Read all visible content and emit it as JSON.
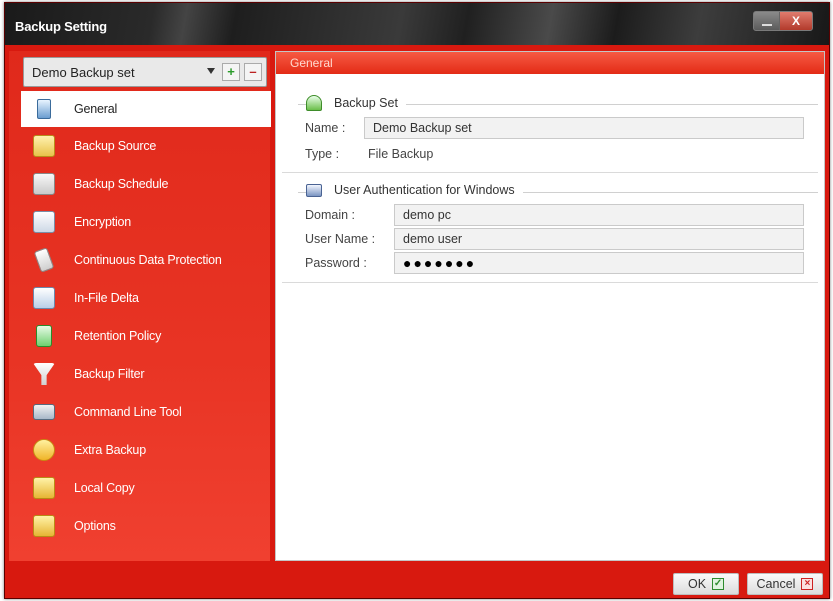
{
  "window": {
    "title": "Backup Setting",
    "close_glyph": "X"
  },
  "sidebar": {
    "selected_set": "Demo Backup set",
    "add_glyph": "+",
    "remove_glyph": "–",
    "items": [
      {
        "label": "General",
        "icon": "general-icon",
        "active": true
      },
      {
        "label": "Backup Source",
        "icon": "backup-source-icon"
      },
      {
        "label": "Backup Schedule",
        "icon": "backup-schedule-icon"
      },
      {
        "label": "Encryption",
        "icon": "encryption-icon"
      },
      {
        "label": "Continuous Data Protection",
        "icon": "cdp-icon"
      },
      {
        "label": "In-File Delta",
        "icon": "in-file-delta-icon"
      },
      {
        "label": "Retention Policy",
        "icon": "retention-policy-icon"
      },
      {
        "label": "Backup Filter",
        "icon": "backup-filter-icon"
      },
      {
        "label": "Command Line Tool",
        "icon": "command-line-tool-icon"
      },
      {
        "label": "Extra Backup",
        "icon": "extra-backup-icon"
      },
      {
        "label": "Local Copy",
        "icon": "local-copy-icon"
      },
      {
        "label": "Options",
        "icon": "options-icon"
      }
    ]
  },
  "content": {
    "header": "General",
    "backup_set": {
      "title": "Backup Set",
      "name_label": "Name :",
      "name_value": "Demo Backup set",
      "type_label": "Type :",
      "type_value": "File Backup"
    },
    "user_auth": {
      "title": "User Authentication for Windows",
      "domain_label": "Domain :",
      "domain_value": "demo pc",
      "username_label": "User Name :",
      "username_value": "demo user",
      "password_label": "Password :",
      "password_value": "●●●●●●●"
    }
  },
  "footer": {
    "ok_label": "OK",
    "ok_glyph": "✓",
    "cancel_label": "Cancel",
    "cancel_glyph": "×"
  },
  "colors": {
    "accent": "#d8190f",
    "header": "#e32b16",
    "titlebar": "#1a1a1a"
  }
}
